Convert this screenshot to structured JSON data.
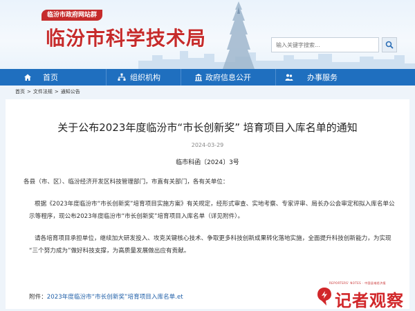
{
  "header": {
    "badge": "临汾市政府网站群",
    "site_name": "临汾市科学技术局",
    "search_placeholder": "输入关键字搜索..."
  },
  "nav": {
    "items": [
      {
        "label": "首页",
        "icon": "home-icon"
      },
      {
        "label": "组织机构",
        "icon": "org-chart-icon"
      },
      {
        "label": "政府信息公开",
        "icon": "building-icon"
      },
      {
        "label": "办事服务",
        "icon": "people-icon"
      }
    ]
  },
  "breadcrumb": {
    "items": [
      "首页",
      "文件法规",
      "通知公告"
    ],
    "separator": ">"
  },
  "article": {
    "title": "关于公布2023年度临汾市“市长创新奖” 培育项目入库名单的通知",
    "date": "2024-03-29",
    "doc_number": "临市科函〔2024〕3号",
    "salutation": "各县（市、区）、临汾经济开发区科技管理部门，市直有关部门，各有关单位：",
    "para1_line1": "根据《2023年度临汾市“市长创新奖”培育项目实施方案》有关规定，经形式审查、实地考察、专家评审、局长办公会审定和拟入库名单公",
    "para1_line2": "示等程序，现公布2023年度临汾市“市长创新奖”培育项目入库名单（详见附件）。",
    "para2_line1": "请各培育项目承担单位，继续加大研发投入、攻克关键核心技术、争取更多科技创新成果转化落地实施，全面提升科技创新能力，为实现",
    "para2_line2": "“三个努力成为”做好科技支撑，为高质量发展做出应有贡献。",
    "attachment_label": "附件：",
    "attachment_link": "2023年度临汾市“市长创新奖”培育项目入库名单.et"
  },
  "watermark": {
    "top_line": "REPORTERS' NOTES · 中国县域经济报",
    "logo_text": "记者观察"
  },
  "colors": {
    "brand_red": "#c62b2b",
    "nav_blue": "#1f6fbf",
    "link_blue": "#1f5fa8"
  }
}
